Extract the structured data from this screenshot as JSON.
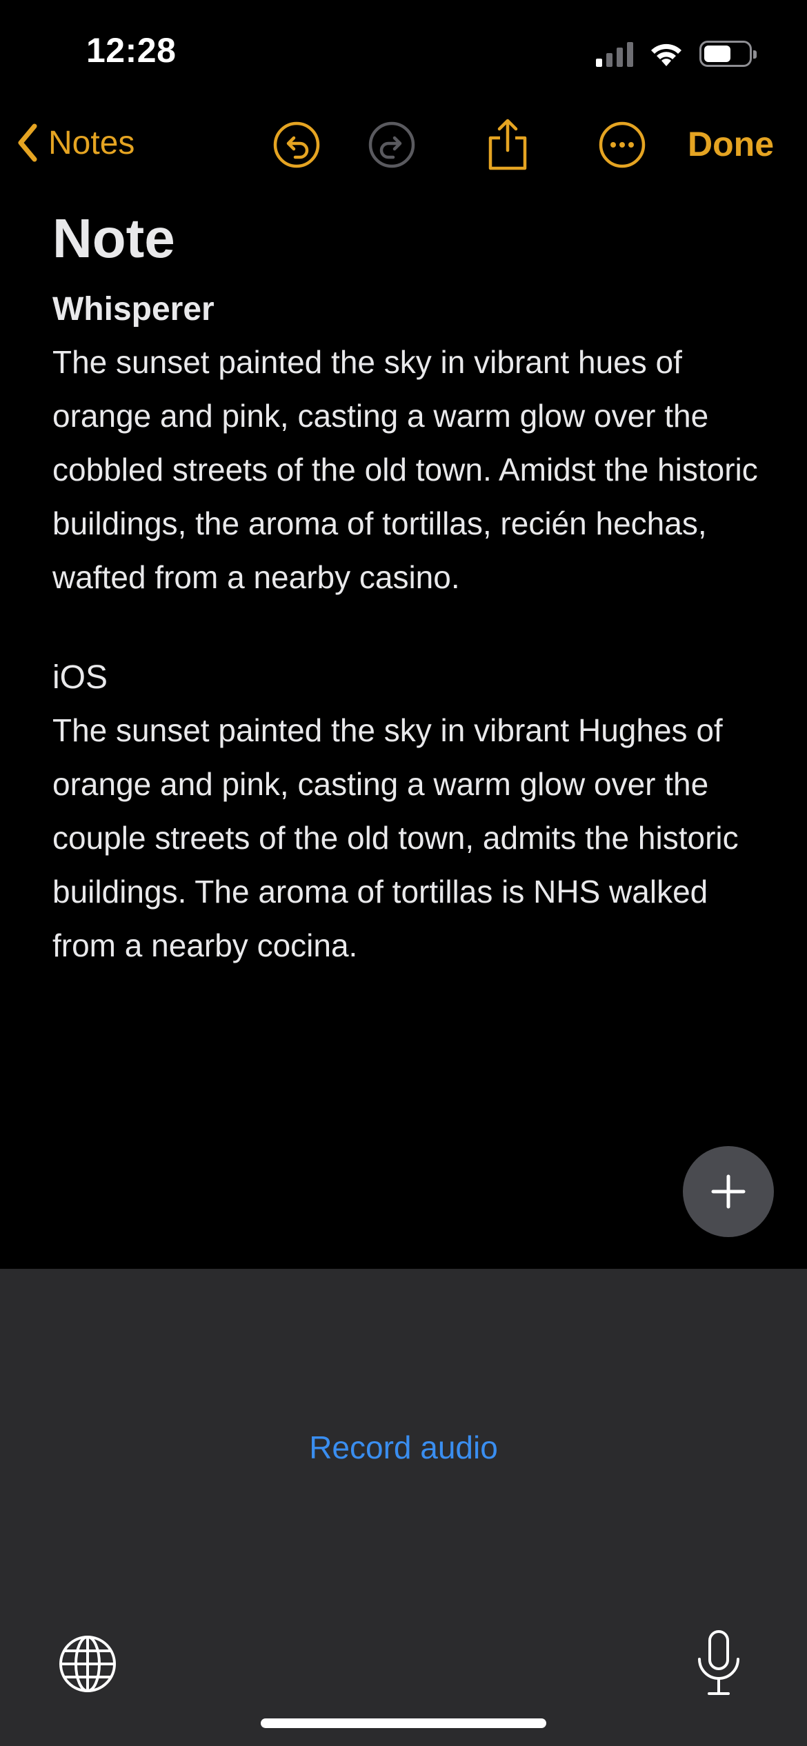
{
  "status_bar": {
    "time": "12:28",
    "signal_bars_active": 1,
    "signal_bars_total": 4,
    "battery_level": 0.6
  },
  "nav": {
    "back_label": "Notes",
    "done_label": "Done"
  },
  "note": {
    "title": "Note",
    "sections": [
      {
        "heading": "Whisperer",
        "body": "The sunset painted the sky in vibrant hues of orange and pink, casting a warm glow over the cobbled streets of the old town. Amidst the historic buildings, the aroma of tortillas, recién hechas, wafted from a nearby casino."
      },
      {
        "heading": "iOS",
        "body": "The sunset painted the sky in vibrant Hughes of orange and pink, casting a warm glow over the couple streets of the old town, admits the historic buildings. The aroma of tortillas is NHS walked from a nearby cocina."
      }
    ]
  },
  "bottom_panel": {
    "record_audio_label": "Record audio"
  },
  "colors": {
    "accent": "#e5a422",
    "link": "#3a8ef0",
    "panel": "#2b2b2d",
    "fab": "#4a4b50"
  }
}
